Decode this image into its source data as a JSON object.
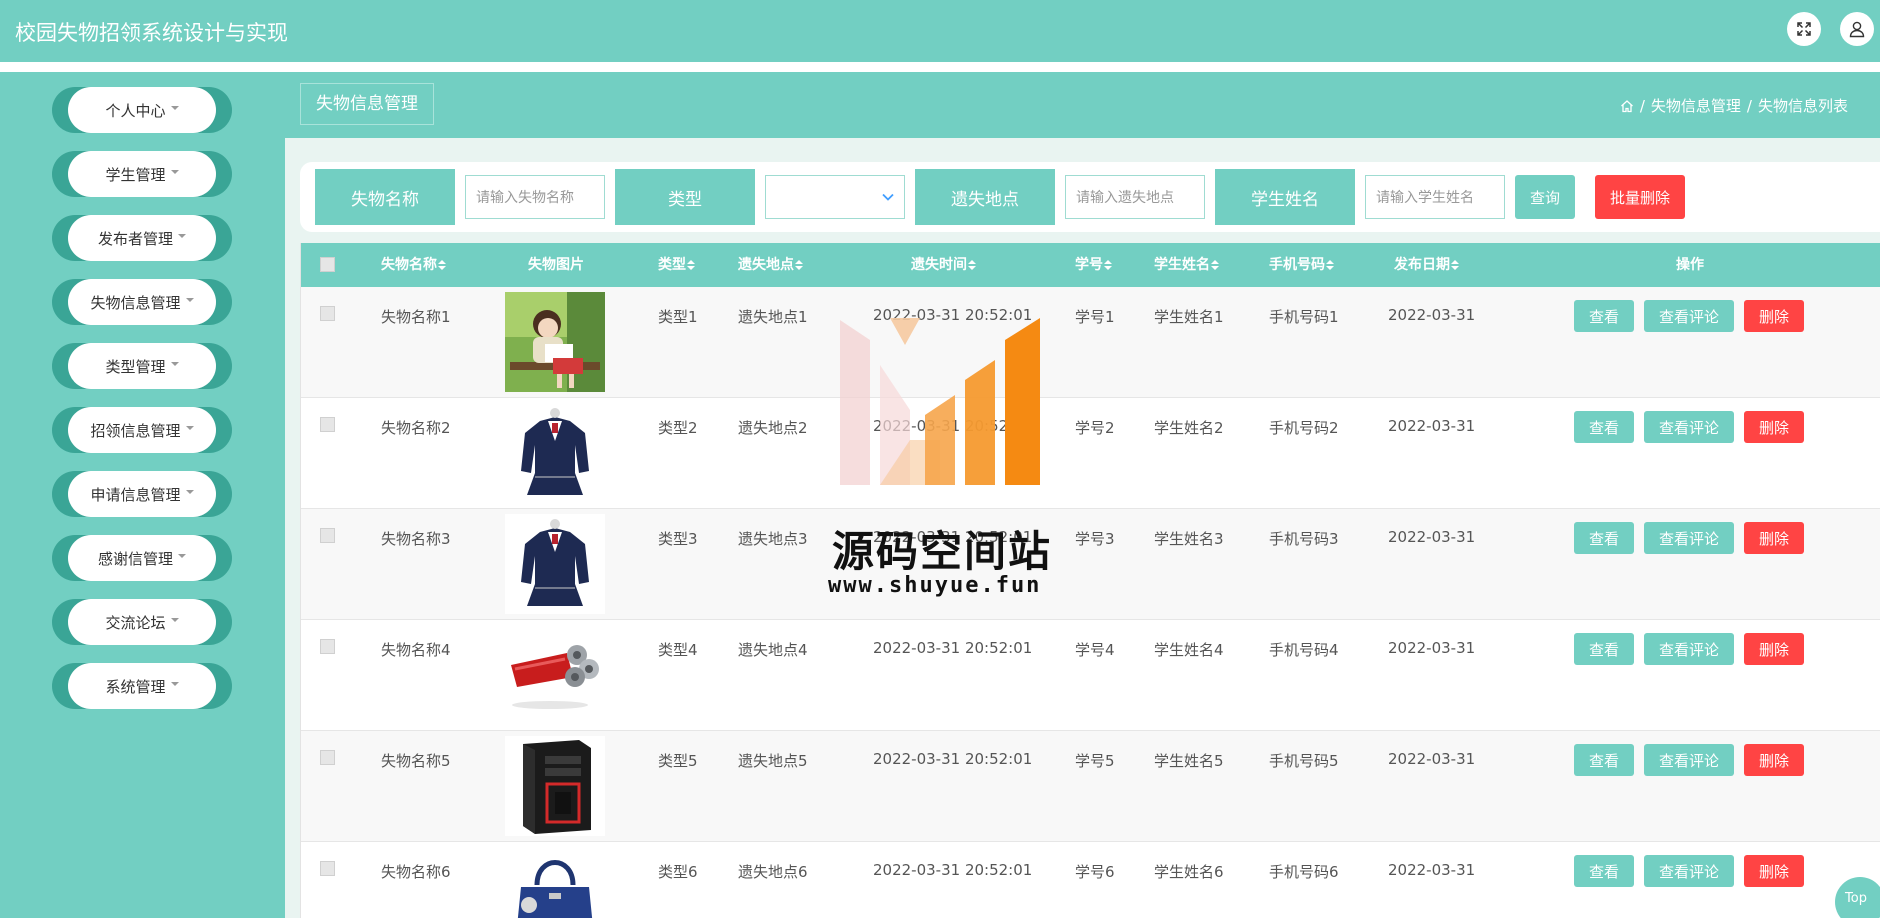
{
  "header": {
    "title": "校园失物招领系统设计与实现",
    "fullscreen_icon": "fullscreen-icon",
    "user_icon": "user-icon"
  },
  "sidebar": {
    "items": [
      {
        "label": "个人中心"
      },
      {
        "label": "学生管理"
      },
      {
        "label": "发布者管理"
      },
      {
        "label": "失物信息管理"
      },
      {
        "label": "类型管理"
      },
      {
        "label": "招领信息管理"
      },
      {
        "label": "申请信息管理"
      },
      {
        "label": "感谢信管理"
      },
      {
        "label": "交流论坛"
      },
      {
        "label": "系统管理"
      }
    ]
  },
  "page": {
    "tag": "失物信息管理",
    "breadcrumb_1": "失物信息管理",
    "breadcrumb_2": "失物信息列表",
    "separator": "/"
  },
  "search": {
    "name_label": "失物名称",
    "name_placeholder": "请输入失物名称",
    "type_label": "类型",
    "type_value": "",
    "place_label": "遗失地点",
    "place_placeholder": "请输入遗失地点",
    "student_label": "学生姓名",
    "student_placeholder": "请输入学生姓名",
    "query_label": "查询",
    "batch_delete_label": "批量删除"
  },
  "table": {
    "columns": [
      "失物名称",
      "失物图片",
      "类型",
      "遗失地点",
      "遗失时间",
      "学号",
      "学生姓名",
      "手机号码",
      "发布日期",
      "操作"
    ],
    "rows": [
      {
        "name": "失物名称1",
        "image": "girl-reading-picture",
        "type": "类型1",
        "place": "遗失地点1",
        "time": "2022-03-31 20:52:01",
        "sno": "学号1",
        "student": "学生姓名1",
        "phone": "手机号码1",
        "date": "2022-03-31"
      },
      {
        "name": "失物名称2",
        "image": "school-uniform-picture",
        "type": "类型2",
        "place": "遗失地点2",
        "time": "2022-03-31 20:52:01",
        "sno": "学号2",
        "student": "学生姓名2",
        "phone": "手机号码2",
        "date": "2022-03-31"
      },
      {
        "name": "失物名称3",
        "image": "school-uniform-picture",
        "type": "类型3",
        "place": "遗失地点3",
        "time": "2022-03-31 20:52:01",
        "sno": "学号3",
        "student": "学生姓名3",
        "phone": "手机号码3",
        "date": "2022-03-31"
      },
      {
        "name": "失物名称4",
        "image": "shaver-picture",
        "type": "类型4",
        "place": "遗失地点4",
        "time": "2022-03-31 20:52:01",
        "sno": "学号4",
        "student": "学生姓名4",
        "phone": "手机号码4",
        "date": "2022-03-31"
      },
      {
        "name": "失物名称5",
        "image": "pc-case-picture",
        "type": "类型5",
        "place": "遗失地点5",
        "time": "2022-03-31 20:52:01",
        "sno": "学号5",
        "student": "学生姓名5",
        "phone": "手机号码5",
        "date": "2022-03-31"
      },
      {
        "name": "失物名称6",
        "image": "handbag-picture",
        "type": "类型6",
        "place": "遗失地点6",
        "time": "2022-03-31 20:52:01",
        "sno": "学号6",
        "student": "学生姓名6",
        "phone": "手机号码6",
        "date": "2022-03-31"
      }
    ],
    "actions": {
      "view": "查看",
      "comment": "查看评论",
      "delete": "删除"
    }
  },
  "watermark": {
    "text": "源码空间站",
    "url": "www.shuyue.fun"
  },
  "top_button": "Top",
  "colors": {
    "primary": "#72cfc2",
    "dark": "#3aa596",
    "danger": "#ff4444"
  }
}
